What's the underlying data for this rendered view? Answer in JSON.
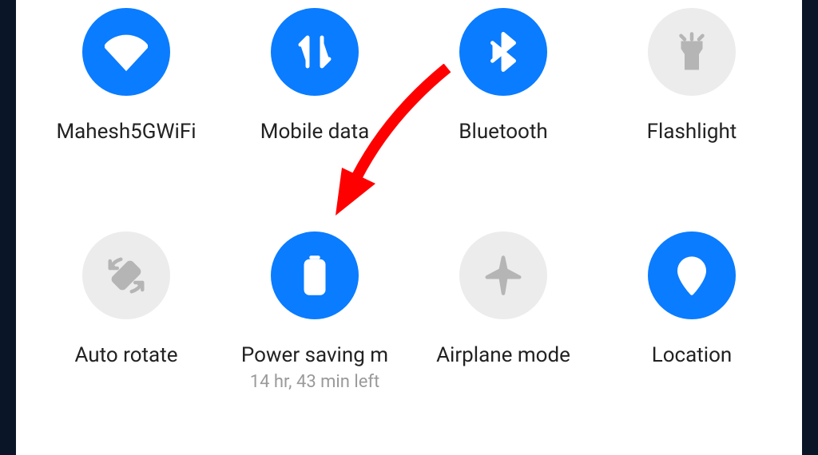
{
  "tiles": [
    {
      "id": "wifi",
      "label": "Mahesh5GWiFi",
      "sub": "",
      "active": true
    },
    {
      "id": "mobile-data",
      "label": "Mobile data",
      "sub": "",
      "active": true
    },
    {
      "id": "bluetooth",
      "label": "Bluetooth",
      "sub": "",
      "active": true
    },
    {
      "id": "flashlight",
      "label": "Flashlight",
      "sub": "",
      "active": false
    },
    {
      "id": "auto-rotate",
      "label": "Auto rotate",
      "sub": "",
      "active": false
    },
    {
      "id": "power-saving",
      "label": "Power saving m",
      "sub": "14 hr, 43 min left",
      "active": true
    },
    {
      "id": "airplane",
      "label": "Airplane mode",
      "sub": "",
      "active": false
    },
    {
      "id": "location",
      "label": "Location",
      "sub": "",
      "active": true
    }
  ],
  "colors": {
    "accent": "#0a7cff",
    "inactive_bg": "#ececec",
    "inactive_fg": "#b5b5b5",
    "arrow": "#ff0000"
  }
}
